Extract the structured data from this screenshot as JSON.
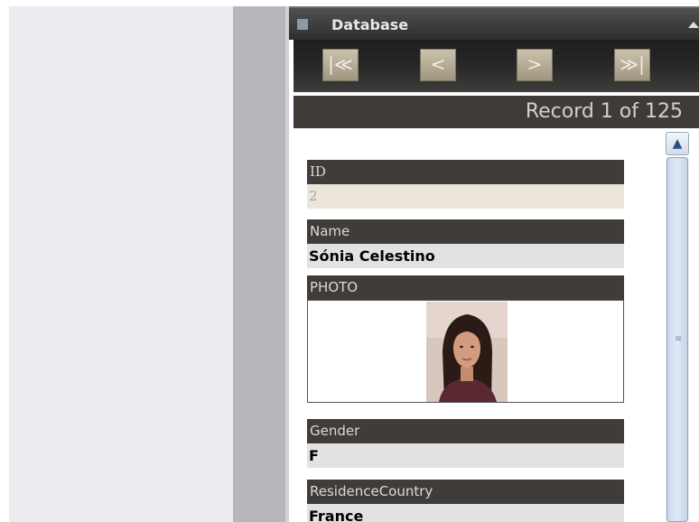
{
  "window": {
    "title": "Database"
  },
  "navigation": {
    "first": "|≪",
    "prev": "<",
    "next": ">",
    "last": "≫|"
  },
  "record_counter": "Record 1 of 125",
  "fields": [
    {
      "label": "ID",
      "value": "2"
    },
    {
      "label": "Name",
      "value": "Sónia Celestino"
    },
    {
      "label": "PHOTO",
      "value": ""
    },
    {
      "label": "Gender",
      "value": "F"
    },
    {
      "label": "ResidenceCountry",
      "value": "France"
    }
  ],
  "colors": {
    "header_dark": "#3f3b39",
    "nav_button": "#b8ae98",
    "id_value_bg": "#ece6da",
    "value_bg": "#e2e2e2",
    "scrollbar": "#c9d6ea"
  }
}
